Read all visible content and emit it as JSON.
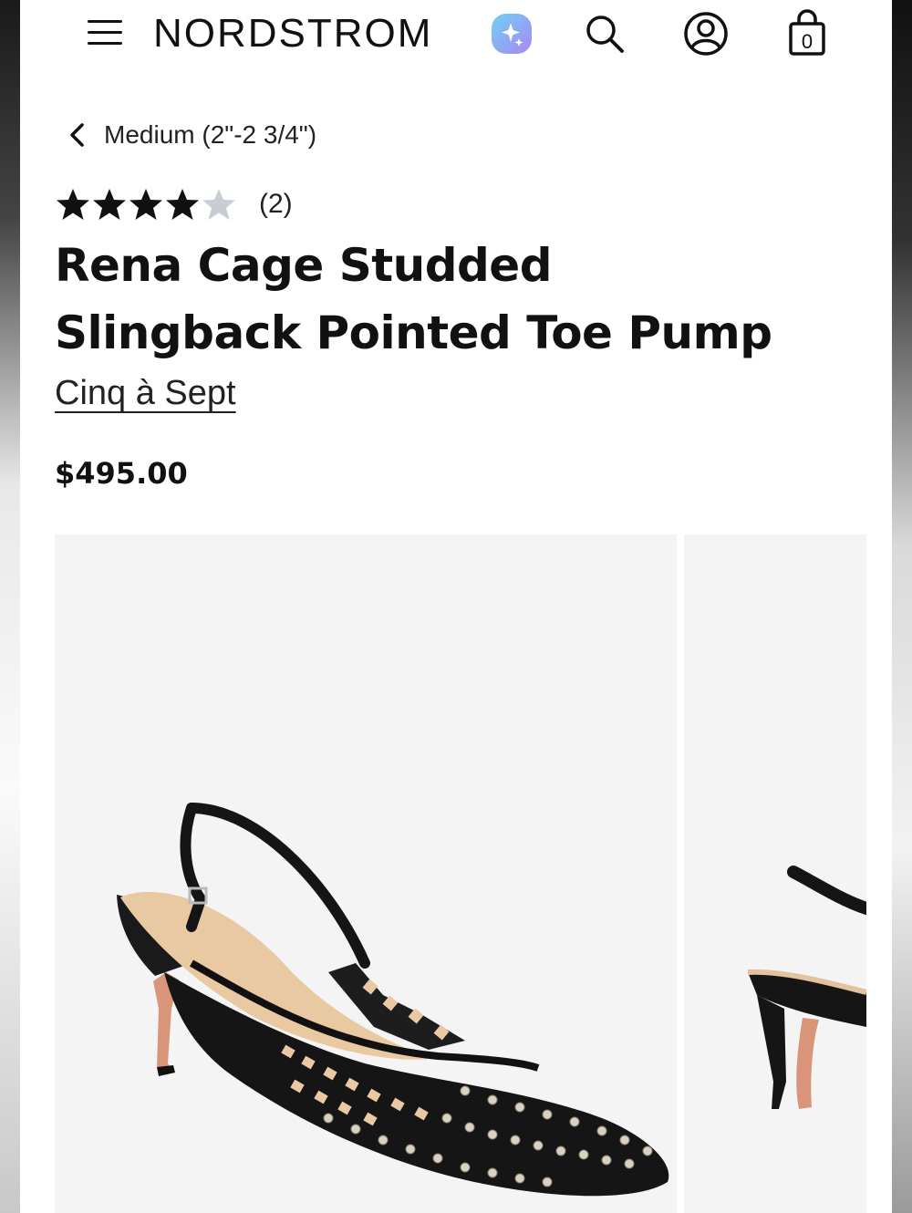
{
  "header": {
    "logo": "NORDSTROM",
    "icons": [
      "menu-icon",
      "ai-sparkle-icon",
      "search-icon",
      "account-icon",
      "shopping-bag-icon"
    ],
    "bag_count": "0",
    "ai_gradient": [
      "#7ec8f2",
      "#a88cf0"
    ]
  },
  "breadcrumb": {
    "label": "Medium (2\"-2 3/4\")"
  },
  "product": {
    "rating": 4,
    "rating_max": 5,
    "review_count": "(2)",
    "title": "Rena Cage Studded Slingback Pointed Toe Pump",
    "brand": "Cinq à Sept",
    "price": "$495.00"
  },
  "gallery": {
    "images": [
      "product-image-main",
      "product-image-side"
    ],
    "background": "#f4f4f4"
  },
  "colors": {
    "star_filled": "#111111",
    "star_empty": "#c7cdd3",
    "text": "#111111"
  }
}
